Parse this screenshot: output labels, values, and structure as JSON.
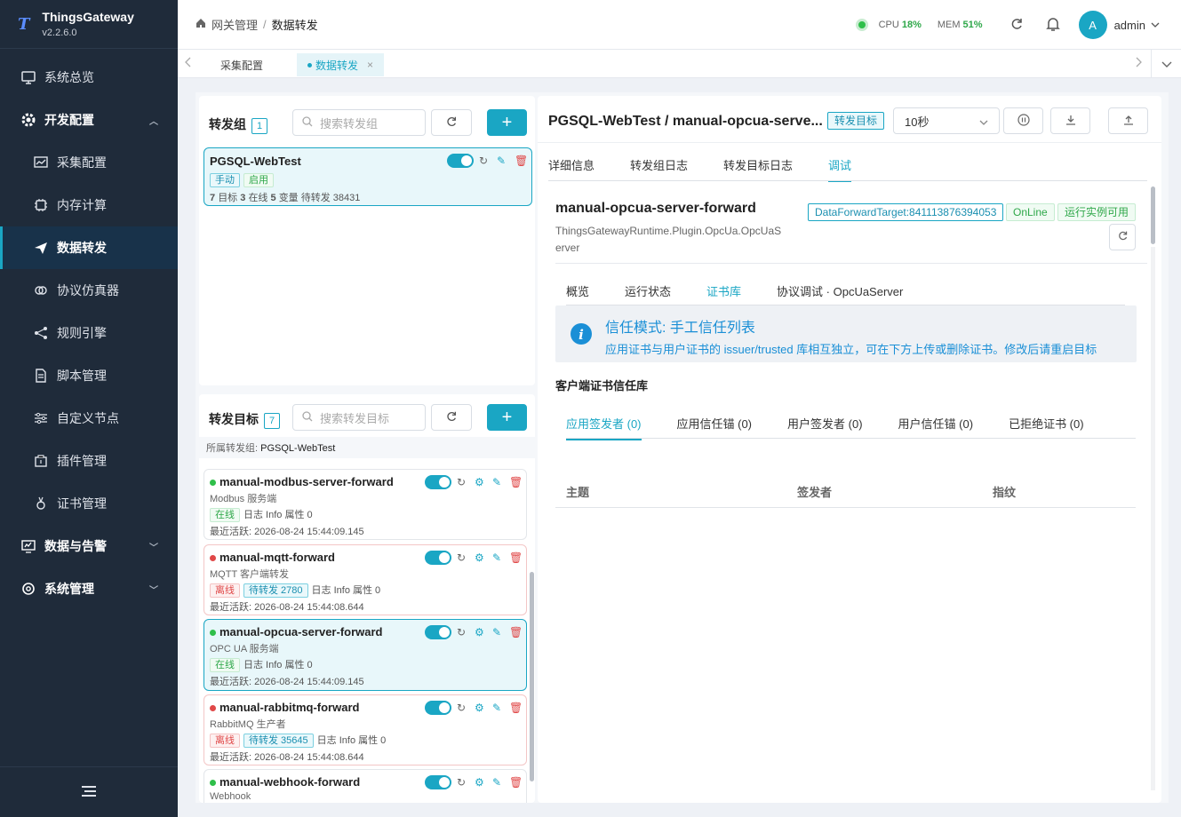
{
  "brand": {
    "logo": "T",
    "name": "ThingsGateway",
    "version": "v2.2.6.0"
  },
  "nav": {
    "overview": "系统总览",
    "dev_config": "开发配置",
    "collect": "采集配置",
    "memory": "内存计算",
    "forward": "数据转发",
    "simulator": "协议仿真器",
    "rules": "规则引擎",
    "scripts": "脚本管理",
    "custom_nodes": "自定义节点",
    "plugins": "插件管理",
    "certs": "证书管理",
    "data_alarm": "数据与告警",
    "system": "系统管理"
  },
  "topbar": {
    "crumb_root": "网关管理",
    "crumb_sep": "/",
    "crumb_current": "数据转发",
    "cpu_label": "CPU",
    "cpu_value": "18%",
    "mem_label": "MEM",
    "mem_value": "51%",
    "avatar_letter": "A",
    "user": "admin"
  },
  "tabs": {
    "tab1": "采集配置",
    "tab2": "数据转发"
  },
  "groups": {
    "title": "转发组",
    "count": "1",
    "search_placeholder": "搜索转发组",
    "item": {
      "name": "PGSQL-WebTest",
      "tag_mode": "手动",
      "tag_state": "启用",
      "targets_num": "7",
      "targets_label": "目标",
      "online_num": "3",
      "online_label": "在线",
      "vars_num": "5",
      "vars_label": "变量",
      "pending": "待转发 38431"
    }
  },
  "targets": {
    "title": "转发目标",
    "count": "7",
    "search_placeholder": "搜索转发目标",
    "group_filter_label": "所属转发组:",
    "group_filter_value": "PGSQL-WebTest",
    "items": [
      {
        "name": "manual-modbus-server-forward",
        "desc": "Modbus 服务端",
        "status": "在线",
        "pending": "",
        "log": "日志 Info",
        "props": "属性 0",
        "last": "最近活跃: 2026-08-24 15:44:09.145",
        "online": true
      },
      {
        "name": "manual-mqtt-forward",
        "desc": "MQTT 客户端转发",
        "status": "离线",
        "pending": "待转发 2780",
        "log": "日志 Info",
        "props": "属性 0",
        "last": "最近活跃: 2026-08-24 15:44:08.644",
        "online": false
      },
      {
        "name": "manual-opcua-server-forward",
        "desc": "OPC UA 服务端",
        "status": "在线",
        "pending": "",
        "log": "日志 Info",
        "props": "属性 0",
        "last": "最近活跃: 2026-08-24 15:44:09.145",
        "online": true
      },
      {
        "name": "manual-rabbitmq-forward",
        "desc": "RabbitMQ 生产者",
        "status": "离线",
        "pending": "待转发 35645",
        "log": "日志 Info",
        "props": "属性 0",
        "last": "最近活跃: 2026-08-24 15:44:08.644",
        "online": false
      },
      {
        "name": "manual-webhook-forward",
        "desc": "Webhook",
        "status": "",
        "pending": "",
        "log": "",
        "props": "",
        "last": "",
        "online": true
      }
    ]
  },
  "detail": {
    "title": "PGSQL-WebTest / manual-opcua-serve...",
    "badge": "转发目标",
    "interval": "10秒",
    "tabs": [
      "详细信息",
      "转发组日志",
      "转发目标日志",
      "调试"
    ],
    "target_name": "manual-opcua-server-forward",
    "plugin_line1": "ThingsGatewayRuntime.Plugin.OpcUa.OpcUaS",
    "plugin_line2": "erver",
    "badge_id": "DataForwardTarget:841113876394053",
    "badge_online": "OnLine",
    "badge_runtime": "运行实例可用",
    "sub_tabs": [
      "概览",
      "运行状态",
      "证书库",
      "协议调试 · OpcUaServer"
    ],
    "notice_title": "信任模式: 手工信任列表",
    "notice_text": "应用证书与用户证书的 issuer/trusted 库相互独立，可在下方上传或删除证书。修改后请重启目标",
    "store_title": "客户端证书信任库",
    "cert_tabs": [
      "应用签发者 (0)",
      "应用信任锚 (0)",
      "用户签发者 (0)",
      "用户信任锚 (0)",
      "已拒绝证书 (0)"
    ],
    "cols": [
      "主题",
      "签发者",
      "指纹"
    ]
  }
}
